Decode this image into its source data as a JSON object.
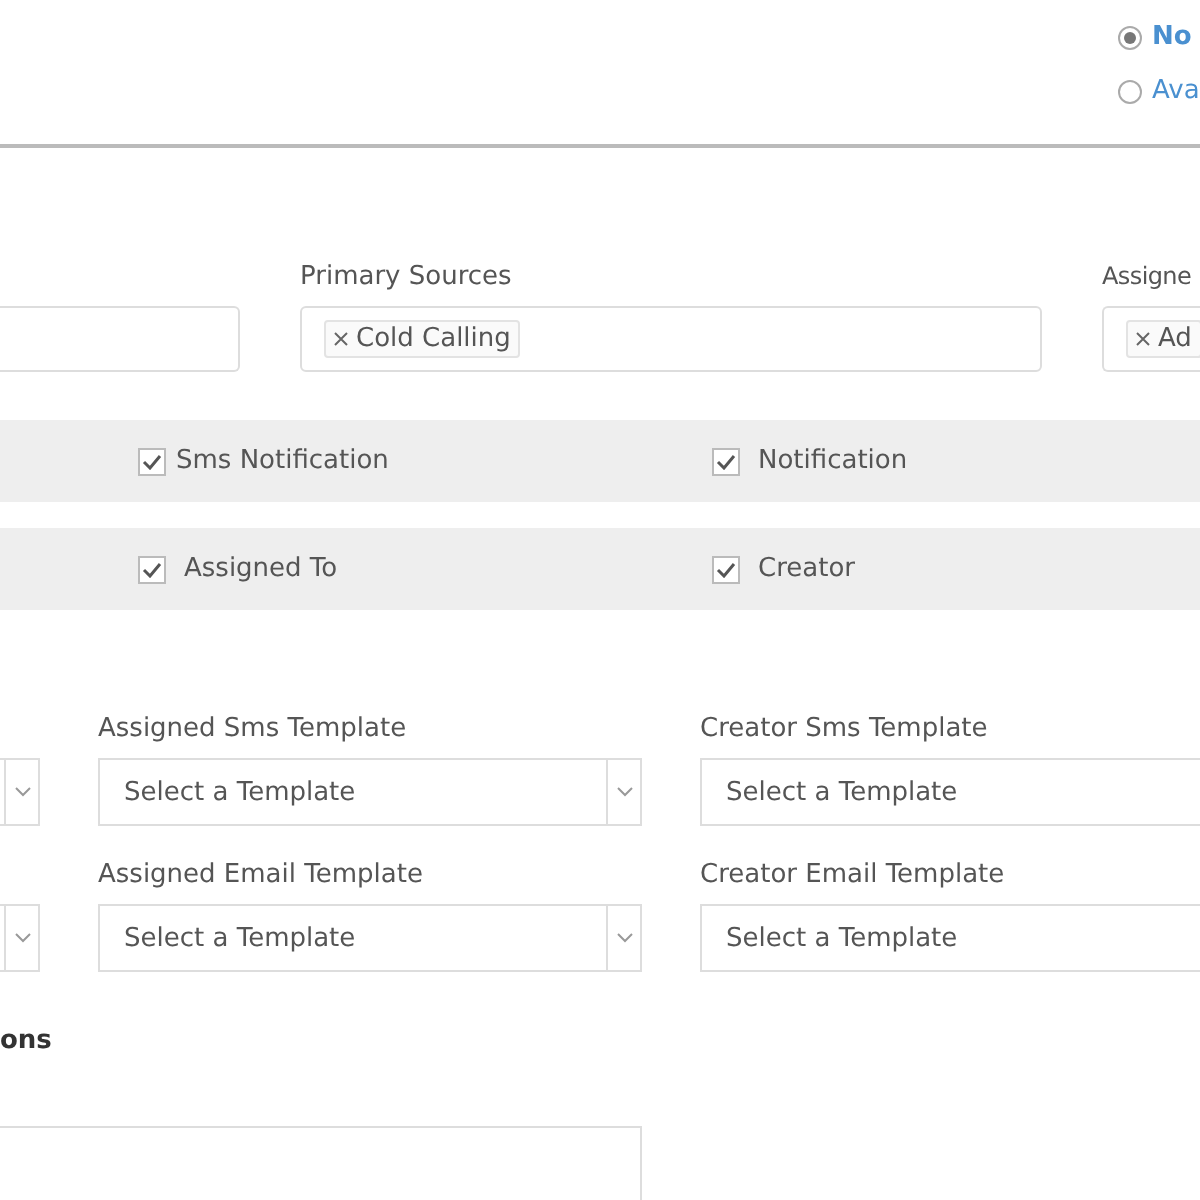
{
  "radios": [
    {
      "label": "No",
      "selected": true
    },
    {
      "label": "Ava",
      "selected": false
    }
  ],
  "fields": [
    {
      "label": "Primary Sources",
      "tags": [
        "Cold Calling"
      ]
    },
    {
      "label": "Assigne",
      "tags": [
        "Ad"
      ]
    }
  ],
  "checkbox_rows": [
    [
      {
        "label": "Sms Notification",
        "checked": true
      },
      {
        "label": "Notification",
        "checked": true
      }
    ],
    [
      {
        "label": "Assigned To",
        "checked": true
      },
      {
        "label": "Creator",
        "checked": true
      }
    ]
  ],
  "template_rows": [
    [
      {
        "label": "Assigned Sms Template",
        "value": "Select a Template"
      },
      {
        "label": "Creator Sms Template",
        "value": "Select a Template"
      }
    ],
    [
      {
        "label": "Assigned Email Template",
        "value": "Select a Template"
      },
      {
        "label": "Creator Email Template",
        "value": "Select a Template"
      }
    ]
  ],
  "section_heading": "ons"
}
